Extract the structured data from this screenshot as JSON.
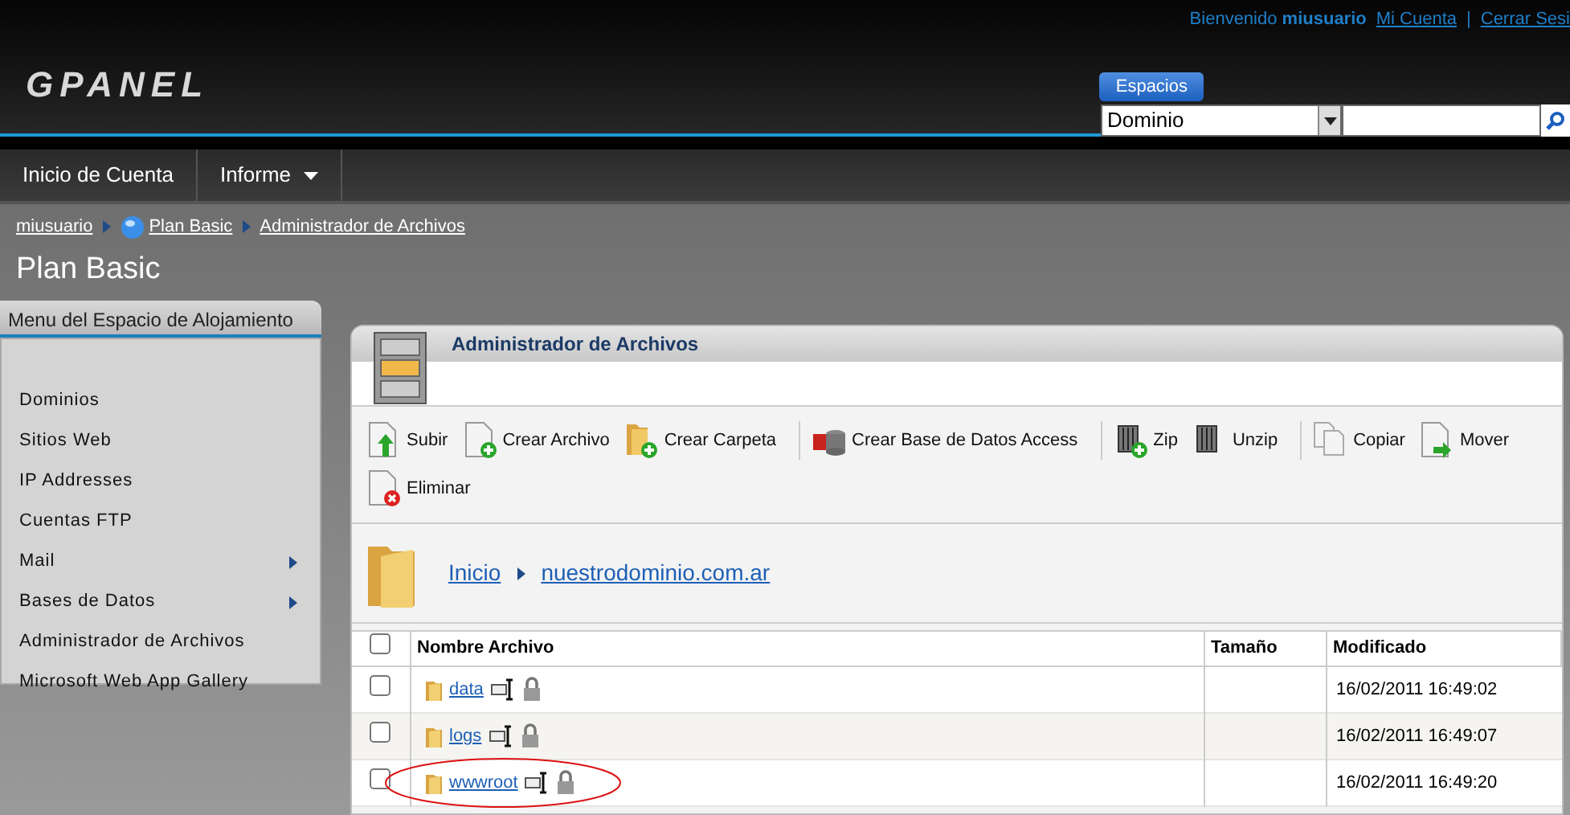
{
  "header": {
    "logo": "GPANEL",
    "welcome": "Bienvenido",
    "username": "miusuario",
    "links": [
      "Mi Cuenta",
      "Cerrar Sesi"
    ],
    "link_separator": "|",
    "spaces_label": "Espacios",
    "spaces_select": "Dominio"
  },
  "nav": [
    {
      "label": "Inicio de Cuenta",
      "has_menu": false
    },
    {
      "label": "Informe",
      "has_menu": true
    }
  ],
  "breadcrumb": [
    {
      "label": "miusuario",
      "globe": false
    },
    {
      "label": "Plan Basic",
      "globe": true
    },
    {
      "label": "Administrador de Archivos",
      "globe": false
    }
  ],
  "page_title": "Plan Basic",
  "sidebar": {
    "title": "Menu del Espacio de Alojamiento",
    "items": [
      {
        "label": "Dominios",
        "has_submenu": false
      },
      {
        "label": "Sitios Web",
        "has_submenu": false
      },
      {
        "label": "IP Addresses",
        "has_submenu": false
      },
      {
        "label": "Cuentas FTP",
        "has_submenu": false
      },
      {
        "label": "Mail",
        "has_submenu": true
      },
      {
        "label": "Bases de Datos",
        "has_submenu": true
      },
      {
        "label": "Administrador de Archivos",
        "has_submenu": false
      },
      {
        "label": "Microsoft Web App Gallery",
        "has_submenu": false
      }
    ]
  },
  "panel": {
    "title": "Administrador de Archivos",
    "toolbar_groups": [
      [
        {
          "label": "Subir",
          "kind": "upload"
        },
        {
          "label": "Crear Archivo",
          "kind": "newfile"
        },
        {
          "label": "Crear Carpeta",
          "kind": "newfolder"
        }
      ],
      [
        {
          "label": "Crear Base de Datos Access",
          "kind": "database"
        }
      ],
      [
        {
          "label": "Zip",
          "kind": "zip"
        },
        {
          "label": "Unzip",
          "kind": "unzip"
        }
      ],
      [
        {
          "label": "Copiar",
          "kind": "copy"
        },
        {
          "label": "Mover",
          "kind": "move"
        },
        {
          "label": "Eliminar",
          "kind": "delete"
        }
      ]
    ],
    "path": [
      "Inicio",
      "nuestrodominio.com.ar"
    ],
    "table": {
      "columns": [
        "Nombre Archivo",
        "Tamaño",
        "Modificado"
      ],
      "select_all_checked": false,
      "rows": [
        {
          "name": "data",
          "modified": "16/02/2011 16:49:02",
          "checked": false,
          "circled": false
        },
        {
          "name": "logs",
          "modified": "16/02/2011 16:49:07",
          "checked": false,
          "circled": false
        },
        {
          "name": "wwwroot",
          "modified": "16/02/2011 16:49:20",
          "checked": false,
          "circled": true
        }
      ]
    }
  }
}
